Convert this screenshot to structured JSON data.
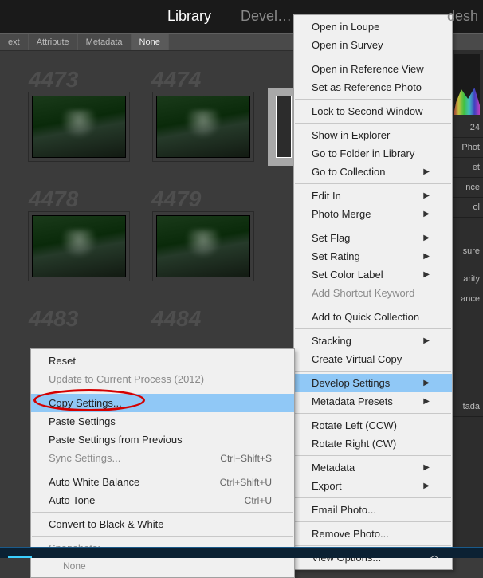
{
  "module_bar": {
    "library": "Library",
    "develop": "Devel…",
    "slideshow_partial": "desh"
  },
  "filter_bar": {
    "text": "ext",
    "attribute": "Attribute",
    "metadata": "Metadata",
    "none": "None"
  },
  "grid": {
    "cells": [
      "4473",
      "4474",
      "4478",
      "4479",
      "4483",
      "4484"
    ]
  },
  "right_panel": {
    "num_label": "24",
    "photo_label": "Phot",
    "items": [
      "et",
      "nce",
      "ol",
      "sure",
      "arity",
      "ance",
      "tada"
    ]
  },
  "context_menu_right": {
    "items": [
      {
        "label": "Open in Loupe"
      },
      {
        "label": "Open in Survey"
      },
      {
        "sep": true
      },
      {
        "label": "Open in Reference View"
      },
      {
        "label": "Set as Reference Photo"
      },
      {
        "sep": true
      },
      {
        "label": "Lock to Second Window"
      },
      {
        "sep": true
      },
      {
        "label": "Show in Explorer"
      },
      {
        "label": "Go to Folder in Library"
      },
      {
        "label": "Go to Collection",
        "sub": true
      },
      {
        "sep": true
      },
      {
        "label": "Edit In",
        "sub": true
      },
      {
        "label": "Photo Merge",
        "sub": true
      },
      {
        "sep": true
      },
      {
        "label": "Set Flag",
        "sub": true
      },
      {
        "label": "Set Rating",
        "sub": true
      },
      {
        "label": "Set Color Label",
        "sub": true
      },
      {
        "label": "Add Shortcut Keyword",
        "disabled": true
      },
      {
        "sep": true
      },
      {
        "label": "Add to Quick Collection"
      },
      {
        "sep": true
      },
      {
        "label": "Stacking",
        "sub": true
      },
      {
        "label": "Create Virtual Copy"
      },
      {
        "sep": true
      },
      {
        "label": "Develop Settings",
        "sub": true,
        "highlight": true
      },
      {
        "label": "Metadata Presets",
        "sub": true
      },
      {
        "sep": true
      },
      {
        "label": "Rotate Left (CCW)"
      },
      {
        "label": "Rotate Right (CW)"
      },
      {
        "sep": true
      },
      {
        "label": "Metadata",
        "sub": true
      },
      {
        "label": "Export",
        "sub": true
      },
      {
        "sep": true
      },
      {
        "label": "Email Photo..."
      },
      {
        "sep": true
      },
      {
        "label": "Remove Photo..."
      },
      {
        "sep": true
      },
      {
        "label": "View Options..."
      }
    ]
  },
  "context_menu_left": {
    "items": [
      {
        "label": "Reset"
      },
      {
        "label": "Update to Current Process (2012)",
        "disabled": true
      },
      {
        "sep": true
      },
      {
        "label": "Copy Settings...",
        "highlight": true
      },
      {
        "label": "Paste Settings"
      },
      {
        "label": "Paste Settings from Previous"
      },
      {
        "label": "Sync Settings...",
        "disabled": true,
        "shortcut": "Ctrl+Shift+S"
      },
      {
        "sep": true
      },
      {
        "label": "Auto White Balance",
        "shortcut": "Ctrl+Shift+U"
      },
      {
        "label": "Auto Tone",
        "shortcut": "Ctrl+U"
      },
      {
        "sep": true
      },
      {
        "label": "Convert to Black & White"
      },
      {
        "sep": true
      },
      {
        "label": "Snapshots:",
        "disabled": true
      },
      {
        "label": "None",
        "indent": true,
        "disabled": true
      }
    ]
  }
}
